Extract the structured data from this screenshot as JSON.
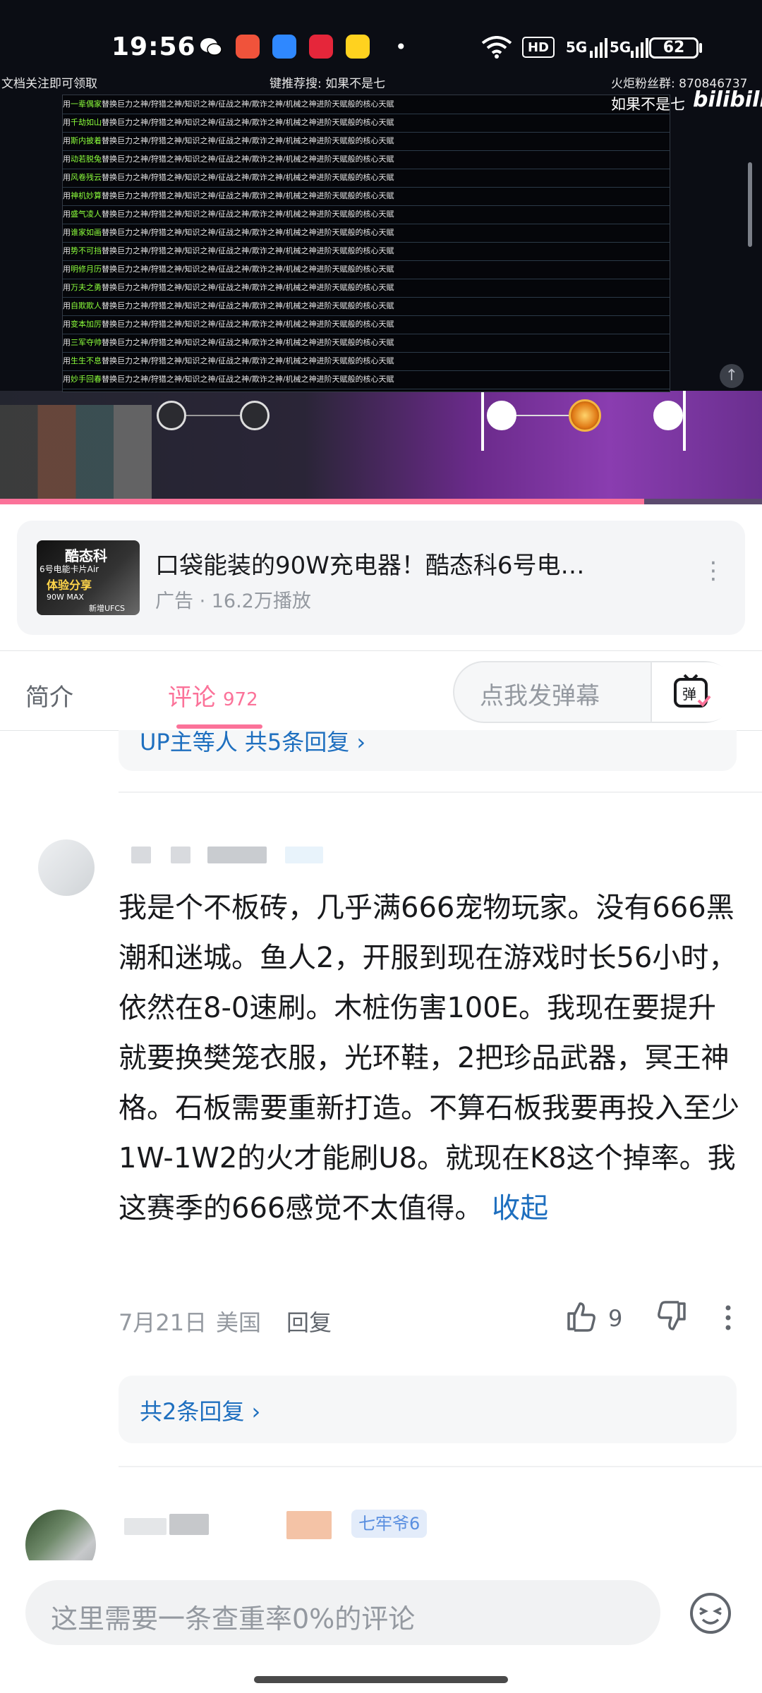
{
  "status_bar": {
    "time": "19:56",
    "hd_label": "HD",
    "net1": "5G",
    "net2": "5G",
    "battery": "62",
    "dot": "•"
  },
  "video": {
    "overlay_left": "文档关注即可领取",
    "overlay_center": "键推荐搜: 如果不是七",
    "overlay_right": "火炬粉丝群: 870846737",
    "watermark_uploader": "如果不是七",
    "watermark_brand": "bilibili",
    "list_rows": [
      {
        "name": "一辈偶家",
        "text": "替换巨力之神/狩猎之神/知识之神/征战之神/欺诈之神/机械之神进阶天赋般的核心天赋"
      },
      {
        "name": "千劫如山",
        "text": "替换巨力之神/狩猎之神/知识之神/征战之神/欺诈之神/机械之神进阶天赋般的核心天赋"
      },
      {
        "name": "斯内披着",
        "text": "替换巨力之神/狩猎之神/知识之神/征战之神/欺诈之神/机械之神进阶天赋般的核心天赋"
      },
      {
        "name": "动若脱兔",
        "text": "替换巨力之神/狩猎之神/知识之神/征战之神/欺诈之神/机械之神进阶天赋般的核心天赋"
      },
      {
        "name": "风卷残云",
        "text": "替换巨力之神/狩猎之神/知识之神/征战之神/欺诈之神/机械之神进阶天赋般的核心天赋"
      },
      {
        "name": "神机妙算",
        "text": "替换巨力之神/狩猎之神/知识之神/征战之神/欺诈之神/机械之神进阶天赋般的核心天赋"
      },
      {
        "name": "盛气凌人",
        "text": "替换巨力之神/狩猎之神/知识之神/征战之神/欺诈之神/机械之神进阶天赋般的核心天赋"
      },
      {
        "name": "谁家如画",
        "text": "替换巨力之神/狩猎之神/知识之神/征战之神/欺诈之神/机械之神进阶天赋般的核心天赋"
      },
      {
        "name": "势不可挡",
        "text": "替换巨力之神/狩猎之神/知识之神/征战之神/欺诈之神/机械之神进阶天赋般的核心天赋"
      },
      {
        "name": "明修月历",
        "text": "替换巨力之神/狩猎之神/知识之神/征战之神/欺诈之神/机械之神进阶天赋般的核心天赋"
      },
      {
        "name": "万夫之勇",
        "text": "替换巨力之神/狩猎之神/知识之神/征战之神/欺诈之神/机械之神进阶天赋般的核心天赋"
      },
      {
        "name": "自欺欺人",
        "text": "替换巨力之神/狩猎之神/知识之神/征战之神/欺诈之神/机械之神进阶天赋般的核心天赋"
      },
      {
        "name": "变本加厉",
        "text": "替换巨力之神/狩猎之神/知识之神/征战之神/欺诈之神/机械之神进阶天赋般的核心天赋"
      },
      {
        "name": "三军夺帅",
        "text": "替换巨力之神/狩猎之神/知识之神/征战之神/欺诈之神/机械之神进阶天赋般的核心天赋"
      },
      {
        "name": "生生不息",
        "text": "替换巨力之神/狩猎之神/知识之神/征战之神/欺诈之神/机械之神进阶天赋般的核心天赋"
      },
      {
        "name": "妙手回春",
        "text": "替换巨力之神/狩猎之神/知识之神/征战之神/欺诈之神/机械之神进阶天赋般的核心天赋"
      }
    ],
    "progress_fraction": 0.845
  },
  "ad": {
    "thumb_title": "酷态科",
    "thumb_line1": "6号电能卡片Air",
    "thumb_line2": "体验分享",
    "thumb_line3": "90W MAX",
    "thumb_line4": "新增UFCS",
    "title": "口袋能装的90W充电器！酷态科6号电…",
    "meta": "广告 · 16.2万播放",
    "more": "⋮"
  },
  "tabs": {
    "intro": "简介",
    "comments": "评论",
    "comment_count": "972",
    "danmaku_placeholder": "点我发弹幕"
  },
  "comment_prev": {
    "reply_summary": "UP主等人 共5条回复 ›"
  },
  "comment": {
    "text": "我是个不板砖，几乎满666宠物玩家。没有666黑潮和迷城。鱼人2，开服到现在游戏时长56小时，依然在8-0速刷。木桩伤害100E。我现在要提升就要换樊笼衣服，光环鞋，2把珍品武器，冥王神格。石板需要重新打造。不算石板我要再投入至少1W-1W2的火才能刷U8。就现在K8这个掉率。我这赛季的666感觉不太值得。",
    "collapse_label": "收起",
    "date": "7月21日",
    "region": "美国",
    "reply_label": "回复",
    "like_count": "9",
    "replies_summary": "共2条回复 ›"
  },
  "comment2": {
    "level_badge": "七牢爷6"
  },
  "bottom": {
    "input_placeholder": "这里需要一条查重率0%的评论"
  }
}
